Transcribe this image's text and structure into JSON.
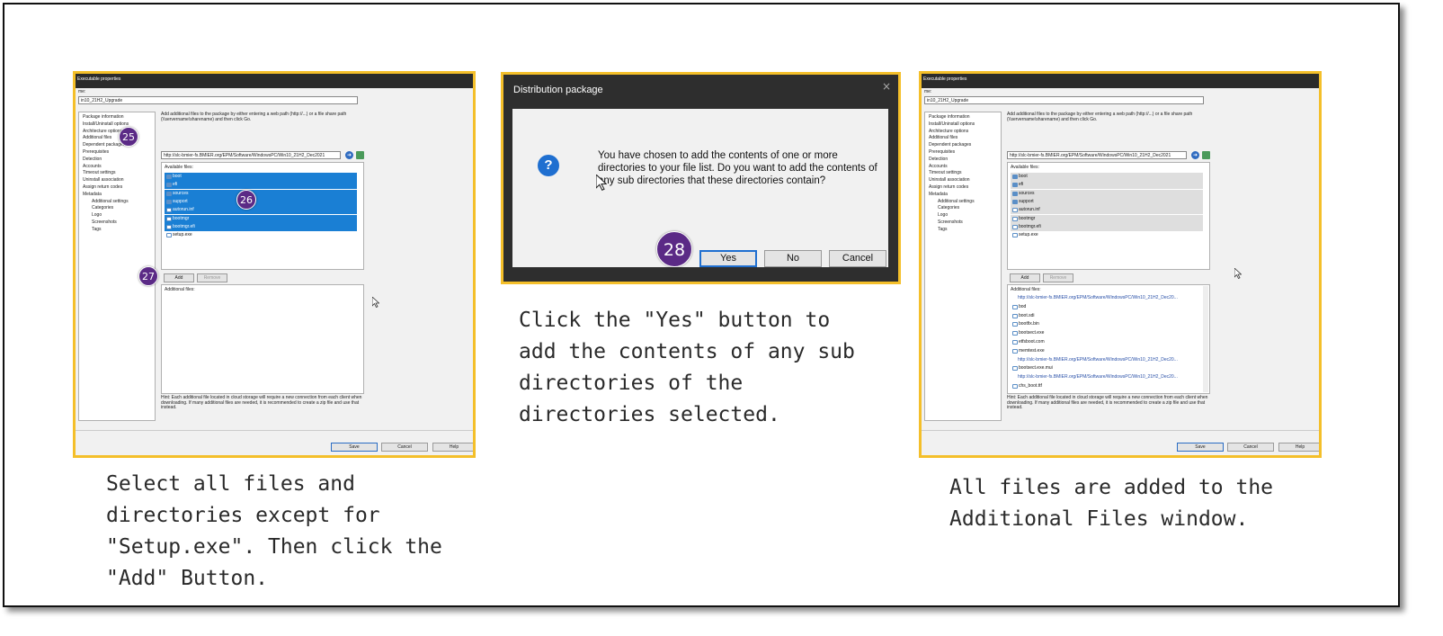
{
  "left": {
    "window_title": "Executable properties",
    "name_label": "me:",
    "name_value": "in10_21H2_Upgrade",
    "tree": [
      "Package information",
      "Install/Uninstall options",
      "Architecture options",
      "Additional files",
      "Dependent packages",
      "Prerequisites",
      "Detection",
      "Accounts",
      "Timeout settings",
      "Uninstall association",
      "Assign return codes",
      "Metadata"
    ],
    "tree_meta": [
      "Additional settings",
      "Categories",
      "Logo",
      "Screenshots",
      "Tags"
    ],
    "instruction": "Add additional files to the package by either entering a web path (http://...) or a file share path (\\\\servername\\sharename) and then click Go.",
    "path_value": "http://slc-bmier-fs.BMIER.org/EPM/Software/WindowsPC/Win10_21H2_Dec2021",
    "available_label": "Available files:",
    "files": [
      "boot",
      "efi",
      "sources",
      "support",
      "autorun.inf",
      "bootmgr",
      "bootmgr.efi",
      "setup.exe"
    ],
    "add_label": "Add",
    "remove_label": "Remove",
    "additional_label": "Additional files:",
    "hint": "Hint: Each additional file located in cloud storage will require a new connection from each client when downloading.  If many additional files are needed, it is recommended to create a zip file and use that instead.",
    "save_label": "Save",
    "cancel_label": "Cancel",
    "help_label": "Help",
    "badge_25": "25",
    "badge_26": "26",
    "badge_27": "27"
  },
  "middle": {
    "dialog_title": "Distribution package",
    "close_glyph": "×",
    "icon_glyph": "?",
    "message": "You have chosen to add the contents of one or more directories to your file list.  Do you want to add the contents of any sub directories that these directories contain?",
    "yes_label": "Yes",
    "no_label": "No",
    "cancel_label": "Cancel",
    "badge_28": "28"
  },
  "right": {
    "window_title": "Executable properties",
    "name_label": "me:",
    "name_value": "in10_21H2_Upgrade",
    "path_value": "http://slc-bmier-fs.BMIER.org/EPM/Software/WindowsPC/Win10_21H2_Dec2021",
    "additional_items": [
      {
        "text": "http://slc-bmier-fs.BMIER.org/EPM/Software/WindowsPC/Win10_21H2_Dec20...",
        "link": true
      },
      {
        "text": "bod",
        "link": false
      },
      {
        "text": "boot.sdi",
        "link": false
      },
      {
        "text": "bootfix.bin",
        "link": false
      },
      {
        "text": "bootsect.exe",
        "link": false
      },
      {
        "text": "etfsboot.com",
        "link": false
      },
      {
        "text": "memtest.exe",
        "link": false
      },
      {
        "text": "http://slc-bmier-fs.BMIER.org/EPM/Software/WindowsPC/Win10_21H2_Dec20...",
        "link": true
      },
      {
        "text": "bootsect.exe.mui",
        "link": false
      },
      {
        "text": "http://slc-bmier-fs.BMIER.org/EPM/Software/WindowsPC/Win10_21H2_Dec20...",
        "link": true
      },
      {
        "text": "chs_boot.ttf",
        "link": false
      }
    ]
  },
  "captions": {
    "left": "Select all files and directories except for \"Setup.exe\".  Then click the \"Add\" Button.",
    "middle": "Click the \"Yes\" button to add the contents of any sub directories of the directories selected.",
    "right": "All files are added to the Additional Files window."
  }
}
